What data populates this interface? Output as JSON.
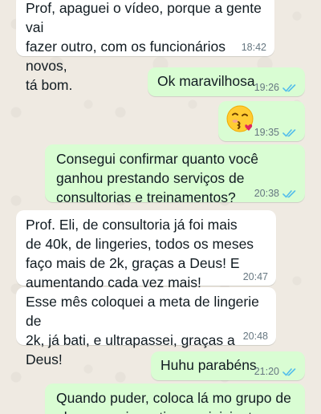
{
  "messages": [
    {
      "dir": "in",
      "text": "Prof, apaguei o vídeo, porque a gente vai\nfazer outro, com os funcionários novos,\ntá bom.",
      "time": "18:42"
    },
    {
      "dir": "out",
      "text": "Ok maravilhosa",
      "time": "19:26",
      "read": true
    },
    {
      "dir": "out",
      "emoji": "kiss-emoji",
      "time": "19:35",
      "read": true
    },
    {
      "dir": "out",
      "text": "Consegui confirmar quanto você\nganhou prestando serviços de\nconsultorias e treinamentos?",
      "time": "20:38",
      "read": true
    },
    {
      "dir": "in",
      "text": "Prof. Eli, de consultoria já foi mais\nde 40k, de lingeries, todos os meses\nfaço mais de 2k, graças a Deus! E\naumentando cada vez mais!",
      "time": "20:47"
    },
    {
      "dir": "in",
      "text": "Esse mês coloquei a meta de lingerie de\n2k, já bati, e ultrapassei, graças a Deus!",
      "time": "20:48"
    },
    {
      "dir": "out",
      "text": "Huhu parabéns",
      "time": "21:20",
      "read": true
    },
    {
      "dir": "out",
      "text": "Quando puder, coloca lá mo grupo de\nalunos pra incentivar os iniciantes."
    }
  ],
  "colors": {
    "incoming": "#ffffff",
    "outgoing": "#d9fdd3",
    "read_ticks": "#53bdeb",
    "wallpaper": "#efeae2"
  }
}
